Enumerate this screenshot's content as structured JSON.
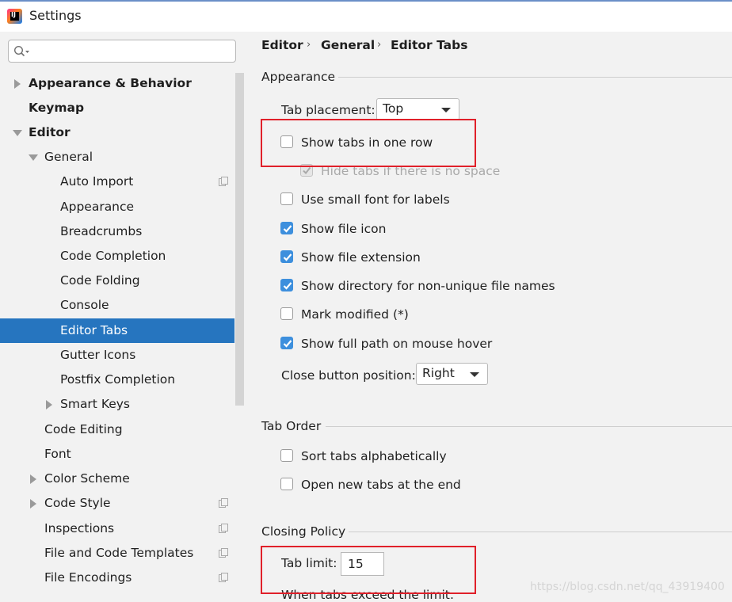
{
  "window": {
    "title": "Settings",
    "app_icon_letter": "IJ"
  },
  "sidebar": {
    "tree": [
      {
        "label": "Appearance & Behavior",
        "bold": true,
        "arrow": "right"
      },
      {
        "label": "Keymap",
        "bold": true
      },
      {
        "label": "Editor",
        "bold": true,
        "arrow": "down"
      },
      {
        "label": "General",
        "arrow": "down"
      },
      {
        "label": "Auto Import",
        "copy_icon": true
      },
      {
        "label": "Appearance"
      },
      {
        "label": "Breadcrumbs"
      },
      {
        "label": "Code Completion"
      },
      {
        "label": "Code Folding"
      },
      {
        "label": "Console"
      },
      {
        "label": "Editor Tabs",
        "selected": true
      },
      {
        "label": "Gutter Icons"
      },
      {
        "label": "Postfix Completion"
      },
      {
        "label": "Smart Keys",
        "arrow": "right"
      },
      {
        "label": "Code Editing"
      },
      {
        "label": "Font"
      },
      {
        "label": "Color Scheme",
        "arrow": "right"
      },
      {
        "label": "Code Style",
        "arrow": "right",
        "copy_icon": true
      },
      {
        "label": "Inspections",
        "copy_icon": true
      },
      {
        "label": "File and Code Templates",
        "copy_icon": true
      },
      {
        "label": "File Encodings",
        "copy_icon": true
      }
    ]
  },
  "breadcrumb": [
    "Editor",
    "General",
    "Editor Tabs"
  ],
  "appearance": {
    "title": "Appearance",
    "tab_placement_label": "Tab placement:",
    "tab_placement_value": "Top",
    "checkboxes": [
      {
        "label": "Show tabs in one row",
        "checked": false
      },
      {
        "label": "Hide tabs if there is no space",
        "checked": true,
        "disabled": true
      },
      {
        "label": "Use small font for labels",
        "checked": false
      },
      {
        "label": "Show file icon",
        "checked": true
      },
      {
        "label": "Show file extension",
        "checked": true
      },
      {
        "label": "Show directory for non-unique file names",
        "checked": true
      },
      {
        "label": "Mark modified (*)",
        "checked": false
      },
      {
        "label": "Show full path on mouse hover",
        "checked": true
      }
    ],
    "close_button_label": "Close button position:",
    "close_button_value": "Right"
  },
  "tab_order": {
    "title": "Tab Order",
    "checkboxes": [
      {
        "label": "Sort tabs alphabetically",
        "checked": false
      },
      {
        "label": "Open new tabs at the end",
        "checked": false
      }
    ]
  },
  "closing_policy": {
    "title": "Closing Policy",
    "tab_limit_label": "Tab limit:",
    "tab_limit_value": "15",
    "exceed_label": "When tabs exceed the limit:"
  },
  "watermark": "https://blog.csdn.net/qq_43919400",
  "colors": {
    "selection": "#2675bf",
    "checkbox_on": "#3d8fdd",
    "highlight_box": "#e0202a"
  }
}
